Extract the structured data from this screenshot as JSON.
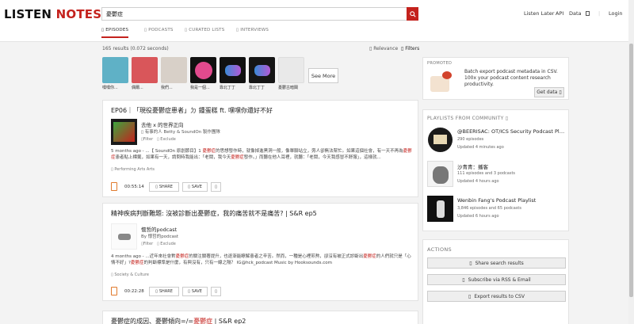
{
  "header": {
    "logo_part1": "LISTEN",
    "logo_part2": "NOTES",
    "search_value": "憂鬱症",
    "nav": [
      "Listen Later",
      "API",
      "Data",
      "",
      "Login"
    ]
  },
  "tabs": [
    {
      "label": "EPISODES",
      "active": true
    },
    {
      "label": "PODCASTS",
      "active": false
    },
    {
      "label": "CURATED LISTS",
      "active": false
    },
    {
      "label": "INTERVIEWS",
      "active": false
    }
  ],
  "results": {
    "count_text": "165 results (0.072 seconds)",
    "relevance": "Relevance",
    "filters": "Filters"
  },
  "thumbs": [
    {
      "label": "嘿嘿你...",
      "color": "#5fb1c6"
    },
    {
      "label": "偶爾...",
      "color": "#d9565a"
    },
    {
      "label": "我們...",
      "color": "#d8d0c8"
    },
    {
      "label": "我是一個...",
      "color": "#e24a8e"
    },
    {
      "label": "靠北丁丁",
      "color": "#111111"
    },
    {
      "label": "靠北丁丁",
      "color": "#151515"
    },
    {
      "label": "憂鬱古暗閣",
      "color": "#e9e9e9"
    }
  ],
  "see_more": "See More",
  "episodes": [
    {
      "title": "EP06｜「現役憂鬱症患者」ㄉ 鍾蛋糕 ft. 嘿嘿你還好不好",
      "podcast": "去他 x 的世界正向",
      "by": "有事的人 Betty & SoundOn 製作團隊",
      "filter": "Filter",
      "exclude": "Exclude",
      "desc_pre": "5 months ago - ...【 SoundOn 原創節目】1 ",
      "desc_hl1": "憂鬱症",
      "desc_mid": "的思想發作時，就像掉進黑洞一般，像單腳站立，旁人卻無法幫忙。如果這個社會，有一天不再為",
      "desc_hl2": "憂鬱症",
      "desc_line2_pre": "患者貼上標籤，如果有一天，請問時我能出：「老闆，我今天",
      "desc_hl3": "憂鬱症",
      "desc_line2_post": "發作。」而聽在他人耳裡，就聽：「老闆，今天我感冒不舒服」，這樣就...",
      "genres": "Performing Arts   Arts",
      "duration": "00:55:14",
      "share": "SHARE",
      "save": "SAVE"
    },
    {
      "title": "精神疾病判斷難題: 沒被診斷出憂鬱症，我的痛苦就不是痛苦? | S&R ep5",
      "podcast": "懷哲的podcast",
      "by": "懷哲的podcast",
      "filter": "Filter",
      "exclude": "Exclude",
      "desc_pre": "4 months ago - ...近年來社會對",
      "desc_hl1": "憂鬱症",
      "desc_mid": "的關注關著提升，也逐漸能瞭解患者之辛苦。然而，一種是心裡煎熬，卻沒有被正式診斷出",
      "desc_hl2": "憂鬱症",
      "desc_line2_pre": "的人們就只是「心情不好」?",
      "desc_hl3": "憂鬱症",
      "desc_line2_post": "的判斷標準是什麼，有與沒有，只有一線之隔？ IG@hck_podcast Music by Hooksounds.com",
      "genres": "Society & Culture",
      "duration": "00:22:28",
      "share": "SHARE",
      "save": "SAVE"
    },
    {
      "title_pre": "憂鬱症的成因、憂鬱傾向=/=",
      "title_hl": "憂鬱症",
      "title_post": " | S&R ep2"
    }
  ],
  "promo": {
    "heading": "PROMOTED",
    "text": "Batch export podcast metadata in CSV. 100x your podcast content research productivity.",
    "button": "Get data"
  },
  "playlists": {
    "heading": "PLAYLISTS FROM COMMUNITY",
    "items": [
      {
        "title": "@BEERISAC: OT/ICS Security Podcast Pla...",
        "sub1": "290 episodes",
        "sub2": "Updated 4 minutes ago"
      },
      {
        "title": "沙青青：播客",
        "sub1": "111 episodes and 3 podcasts",
        "sub2": "Updated 4 hours ago"
      },
      {
        "title": "Wenbin Fang's Podcast Playlist",
        "sub1": "3,846 episodes and 65 podcasts",
        "sub2": "Updated 6 hours ago"
      }
    ]
  },
  "actions": {
    "heading": "ACTIONS",
    "buttons": [
      "Share search results",
      "Subscribe via RSS & Email",
      "Export results to CSV"
    ]
  },
  "colors": {
    "brand_red": "#c4221d",
    "play_orange": "#e07a2c"
  }
}
